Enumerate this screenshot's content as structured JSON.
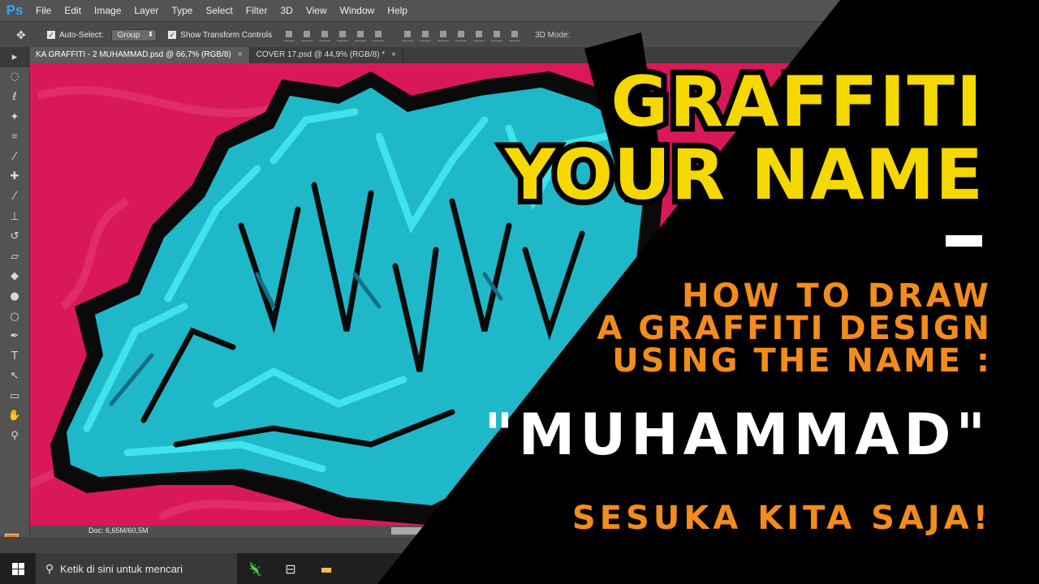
{
  "app": {
    "logo": "Ps",
    "menu": [
      "File",
      "Edit",
      "Image",
      "Layer",
      "Type",
      "Select",
      "Filter",
      "3D",
      "View",
      "Window",
      "Help"
    ]
  },
  "options_bar": {
    "auto_select_label": "Auto-Select:",
    "auto_select_value": "Group",
    "show_transform_label": "Show Transform Controls",
    "mode_3d_label": "3D Mode:"
  },
  "tabs": [
    {
      "label": "KA GRAFFITI - 2 MUHAMMAD.psd @ 66,7% (RGB/8)",
      "close": "×"
    },
    {
      "label": "COVER 17.psd @ 44,9% (RGB/8) *",
      "close": "×"
    }
  ],
  "status": {
    "doc": "Doc: 6,65M/60,5M"
  },
  "taskbar": {
    "search_placeholder": "Ketik di sini untuk mencari"
  },
  "thumbnail": {
    "title_line1": "GRAFFITI",
    "title_line2": "YOUR NAME",
    "sub_line1": "HOW TO DRAW",
    "sub_line2": "A GRAFFITI DESIGN",
    "sub_line3": "USING THE NAME :",
    "name": "\"MUHAMMAD\"",
    "tagline": "SESUKA KITA SAJA!"
  },
  "colors": {
    "canvas_bg": "#d9185a",
    "graffiti_fill": "#1fb8c9",
    "graffiti_light": "#3ee3ec",
    "title_yellow": "#f5d800",
    "sub_orange": "#f28c1c",
    "foreground_swatch": "#f07c12"
  },
  "icons": [
    "move-icon",
    "marquee-icon",
    "lasso-icon",
    "magic-wand-icon",
    "crop-icon",
    "eyedropper-icon",
    "healing-icon",
    "brush-icon",
    "stamp-icon",
    "history-brush-icon",
    "eraser-icon",
    "bucket-icon",
    "blur-icon",
    "dodge-icon",
    "pen-icon",
    "type-icon",
    "path-select-icon",
    "rectangle-icon",
    "hand-icon",
    "zoom-icon",
    "windows-icon",
    "search-icon",
    "task-view-icon",
    "file-explorer-icon"
  ]
}
